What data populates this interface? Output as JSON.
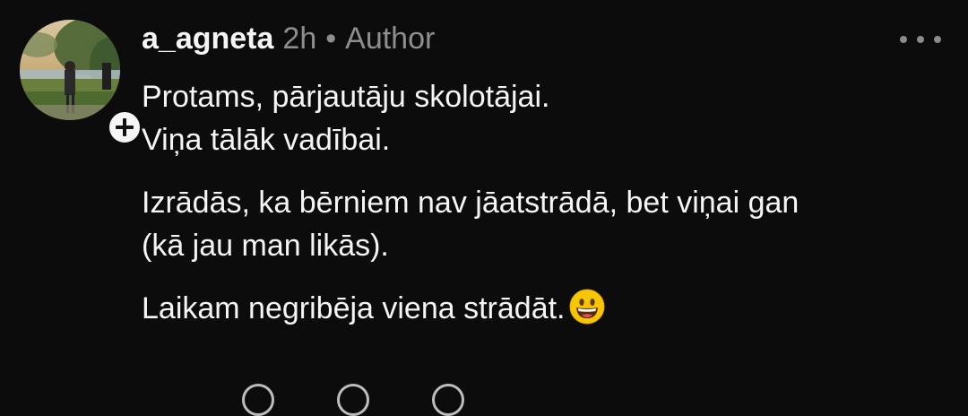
{
  "comment": {
    "avatar_icon": "user-photo-avatar",
    "follow_icon": "plus-icon",
    "username": "a_agneta",
    "time": "2h",
    "separator": "•",
    "role": "Author",
    "more_icon": "more-horizontal-icon",
    "paragraphs": [
      [
        "Protams, pārjautāju skolotājai.",
        "Viņa tālāk vadībai."
      ],
      [
        "Izrādās, ka bērniem nav jāatstrādā, bet viņai gan",
        "(kā jau man likās)."
      ],
      [
        "Laikam negribēja viena strādāt."
      ]
    ],
    "emoji_icon": "grinning-face-emoji"
  },
  "colors": {
    "background": "#0c0c0c",
    "text": "#f5f5f5",
    "muted": "#8e8e8e"
  }
}
